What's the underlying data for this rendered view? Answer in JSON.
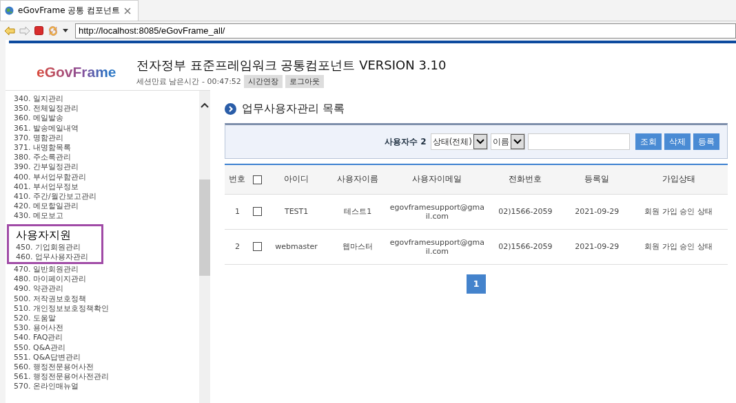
{
  "browser": {
    "tab_title": "eGovFrame 공통 컴포넌트",
    "url": "http://localhost:8085/eGovFrame_all/"
  },
  "header": {
    "logo": "eGovFrame",
    "title": "전자정부 표준프레임워크 공통컴포넌트 VERSION 3.10",
    "session_label": "세션만료 남은시간 - 00:47:52",
    "buttons": [
      "시간연장",
      "로그아웃"
    ]
  },
  "sidebar": {
    "items_before": [
      "340. 일지관리",
      "350. 전체일정관리",
      "360. 메일발송",
      "361. 발송메일내역",
      "370. 명함관리",
      "371. 내명함목록",
      "380. 주소록관리",
      "390. 간부일정관리",
      "400. 부서업무함관리",
      "401. 부서업무정보",
      "410. 주간/월간보고관리",
      "420. 메모할일관리",
      "430. 메모보고"
    ],
    "highlight": {
      "heading": "사용자지원",
      "items": [
        "450. 기업회원관리",
        "460. 업무사용자관리"
      ]
    },
    "items_after": [
      "470. 일반회원관리",
      "480. 마이페이지관리",
      "490. 약관관리",
      "500. 저작권보호정책",
      "510. 개인정보보호정책확인",
      "520. 도움말",
      "530. 용어사전",
      "540. FAQ관리",
      "550. Q&A관리",
      "551. Q&A답변관리",
      "560. 행정전문용어사전",
      "561. 행정전문용어사전관리",
      "570. 온라인매뉴얼"
    ]
  },
  "main": {
    "heading": "업무사용자관리 목록",
    "search": {
      "count_label": "사용자수 2",
      "status_select": "상태(전체)",
      "field_select": "이름",
      "buttons": [
        "조회",
        "삭제",
        "등록"
      ]
    },
    "table": {
      "columns": [
        "번호",
        "",
        "아이디",
        "사용자이름",
        "사용자이메일",
        "전화번호",
        "등록일",
        "가입상태"
      ],
      "header_checked": false,
      "rows": [
        {
          "no": "1",
          "checked": false,
          "id": "TEST1",
          "name": "테스트1",
          "email": "egovframesupport@gmail.com",
          "phone": "02)1566-2059",
          "date": "2021-09-29",
          "status": "회원 가입 승인 상태"
        },
        {
          "no": "2",
          "checked": false,
          "id": "webmaster",
          "name": "웹마스터",
          "email": "egovframesupport@gmail.com",
          "phone": "02)1566-2059",
          "date": "2021-09-29",
          "status": "회원 가입 승인 상태"
        }
      ]
    },
    "pagination": [
      {
        "label": "1",
        "selected": true
      }
    ]
  }
}
